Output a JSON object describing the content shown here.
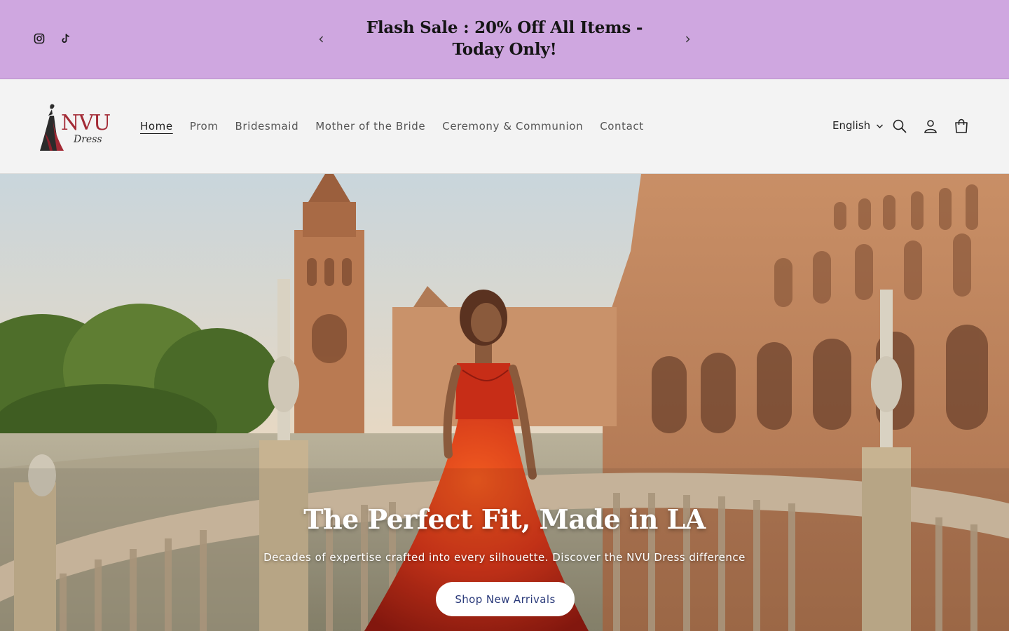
{
  "announcement": {
    "text": "Flash Sale : 20% Off All Items - Today Only!",
    "background": "#cfa7e0",
    "social_icons": [
      "instagram-icon",
      "tiktok-icon"
    ],
    "prev_icon": "chevron-left-icon",
    "next_icon": "chevron-right-icon"
  },
  "header": {
    "logo_text": "NVU",
    "logo_subtext": "Dress",
    "nav": [
      {
        "label": "Home",
        "active": true
      },
      {
        "label": "Prom"
      },
      {
        "label": "Bridesmaid"
      },
      {
        "label": "Mother of the Bride"
      },
      {
        "label": "Ceremony & Communion"
      },
      {
        "label": "Contact"
      }
    ],
    "language": "English",
    "icons": [
      "search-icon",
      "account-icon",
      "cart-icon"
    ]
  },
  "hero": {
    "title": "The Perfect Fit, Made in LA",
    "subtitle": "Decades of expertise crafted into every silhouette. Discover the NVU Dress difference",
    "button_label": "Shop New Arrivals",
    "button_text_color": "#2a3a7a"
  }
}
